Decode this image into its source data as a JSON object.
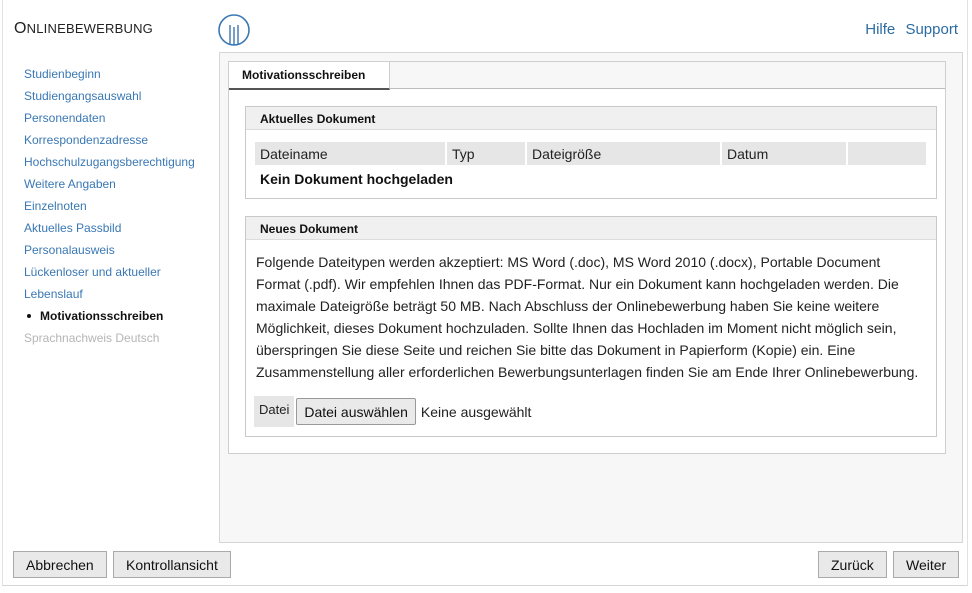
{
  "header": {
    "app_title_cap": "O",
    "app_title_rest": "NLINEBEWERBUNG",
    "links": [
      "Hilfe",
      "Support"
    ]
  },
  "sidebar": {
    "items": [
      {
        "label": "Studienbeginn",
        "state": "link"
      },
      {
        "label": "Studiengangsauswahl",
        "state": "link"
      },
      {
        "label": "Personendaten",
        "state": "link"
      },
      {
        "label": "Korrespondenzadresse",
        "state": "link"
      },
      {
        "label": "Hochschulzugangsberechtigung",
        "state": "link"
      },
      {
        "label": "Weitere Angaben",
        "state": "link"
      },
      {
        "label": "Einzelnoten",
        "state": "link"
      },
      {
        "label": "Aktuelles Passbild",
        "state": "link"
      },
      {
        "label": "Personalausweis",
        "state": "link"
      },
      {
        "label": "Lückenloser und aktueller",
        "state": "link"
      },
      {
        "label": "Lebenslauf",
        "state": "link"
      },
      {
        "label": "Motivationsschreiben",
        "state": "active"
      },
      {
        "label": "Sprachnachweis Deutsch",
        "state": "disabled"
      }
    ]
  },
  "main": {
    "tab_label": "Motivationsschreiben",
    "current_doc": {
      "heading": "Aktuelles Dokument",
      "columns": [
        "Dateiname",
        "Typ",
        "Dateigröße",
        "Datum",
        ""
      ],
      "empty_text": "Kein Dokument hochgeladen"
    },
    "new_doc": {
      "heading": "Neues Dokument",
      "lines": [
        "Folgende Dateitypen werden akzeptiert: MS Word (.doc), MS Word 2010 (.docx), Portable Document",
        "Format (.pdf). Wir empfehlen Ihnen das PDF-Format. Nur ein Dokument kann hochgeladen werden. Die",
        "maximale Dateigröße beträgt 50 MB. Nach Abschluss der Onlinebewerbung haben Sie keine weitere",
        "Möglichkeit, dieses Dokument hochzuladen. Sollte Ihnen das Hochladen im Moment nicht möglich sein,",
        "überspringen Sie diese Seite und reichen Sie bitte das Dokument in Papierform (Kopie) ein. Eine",
        "Zusammenstellung aller erforderlichen Bewerbungsunterlagen finden Sie am Ende Ihrer Onlinebewerbung."
      ],
      "file_label": "Datei",
      "file_button": "Datei auswählen",
      "file_status": "Keine ausgewählt"
    }
  },
  "footer": {
    "cancel": "Abbrechen",
    "review": "Kontrollansicht",
    "back": "Zurück",
    "next": "Weiter"
  },
  "colors": {
    "link": "#3a78b4",
    "header_link": "#2b6ca3",
    "logo": "#3a78b4"
  }
}
